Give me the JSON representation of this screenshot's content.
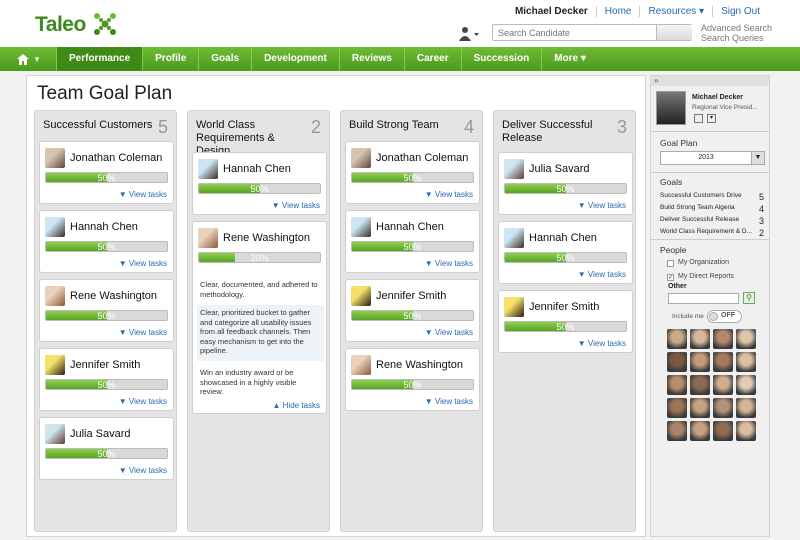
{
  "header": {
    "logo": "Taleo",
    "user_name": "Michael Decker",
    "links": [
      "Home",
      "Resources ▾",
      "Sign Out"
    ],
    "search_placeholder": "Search Candidate",
    "advanced_search": "Advanced Search",
    "search_queries": "Search Queries"
  },
  "nav": {
    "home_label": "▾",
    "items": [
      "Performance",
      "Profile",
      "Goals",
      "Development",
      "Reviews",
      "Career",
      "Succession",
      "More ▾"
    ]
  },
  "page": {
    "title": "Team Goal Plan"
  },
  "columns": [
    {
      "title": "Successful Customers",
      "count": "5",
      "cards": [
        {
          "name": "Jonathan Coleman",
          "progress": "50%",
          "link": "View tasks"
        },
        {
          "name": "Hannah Chen",
          "progress": "50%",
          "link": "View tasks"
        },
        {
          "name": "Rene Washington",
          "progress": "50%",
          "link": "View tasks"
        },
        {
          "name": "Jennifer Smith",
          "progress": "50%",
          "link": "View tasks"
        },
        {
          "name": "Julia Savard",
          "progress": "50%",
          "link": "View tasks"
        }
      ]
    },
    {
      "title": "World Class Requirements & Design",
      "count": "2",
      "cards": [
        {
          "name": "Hannah Chen",
          "progress": "50%",
          "link": "View tasks"
        },
        {
          "name": "Rene Washington",
          "progress": "30%",
          "link": "Hide tasks",
          "tasks": [
            "Clear, documented, and adhered to methodology.",
            "Clear, prioritized bucket to gather and categorize all usability issues from all feedback channels. Then easy mechanism to get into the pipeline.",
            "Win an industry award or be showcased in a highly visible review."
          ]
        }
      ]
    },
    {
      "title": "Build Strong Team",
      "count": "4",
      "cards": [
        {
          "name": "Jonathan Coleman",
          "progress": "50%",
          "link": "View tasks"
        },
        {
          "name": "Hannah Chen",
          "progress": "50%",
          "link": "View tasks"
        },
        {
          "name": "Jennifer Smith",
          "progress": "50%",
          "link": "View tasks"
        },
        {
          "name": "Rene Washington",
          "progress": "50%",
          "link": "View tasks"
        }
      ]
    },
    {
      "title": "Deliver Successful Release",
      "count": "3",
      "cards": [
        {
          "name": "Julia Savard",
          "progress": "50%",
          "link": "View tasks"
        },
        {
          "name": "Hannah Chen",
          "progress": "50%",
          "link": "View tasks"
        },
        {
          "name": "Jennifer Smith",
          "progress": "50%",
          "link": "View tasks"
        }
      ]
    }
  ],
  "sidebar": {
    "collapse": "»",
    "profile_name": "Michael Decker",
    "profile_title": "Regional Vice Presid...",
    "goal_plan_label": "Goal Plan",
    "goal_plan_value": "2013",
    "goals_label": "Goals",
    "goals": [
      {
        "name": "Successful Customers Drive",
        "count": "5"
      },
      {
        "name": "Build Strong Team Algeria",
        "count": "4"
      },
      {
        "name": "Deliver Successful Release",
        "count": "3"
      },
      {
        "name": "World Class Requirement & D...",
        "count": "2"
      }
    ],
    "people_label": "People",
    "my_organization": "My Organization",
    "my_direct_reports": "My Direct Reports",
    "other_label": "Other",
    "include_me": "Include me",
    "toggle_off": "OFF"
  },
  "colors": {
    "brand_green": "#4a9a1f",
    "link_blue": "#2a6ab3"
  }
}
